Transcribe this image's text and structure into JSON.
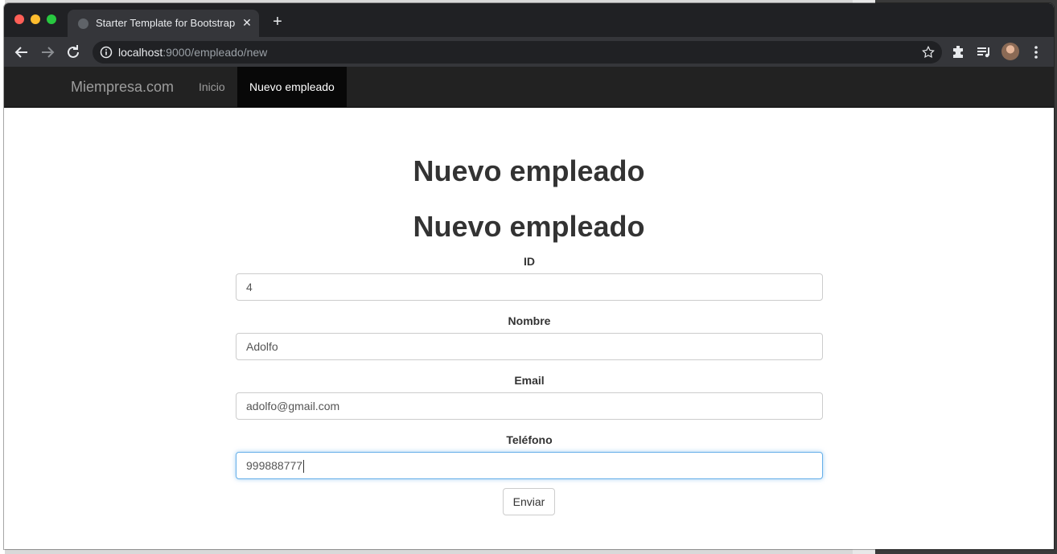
{
  "browser": {
    "tab_title": "Starter Template for Bootstrap",
    "url_host": "localhost",
    "url_path": ":9000/empleado/new",
    "icons": [
      "back-icon",
      "forward-icon",
      "reload-icon",
      "info-icon",
      "star-icon",
      "extensions-icon",
      "media-icon",
      "avatar",
      "menu-icon"
    ]
  },
  "navbar": {
    "brand": "Miempresa.com",
    "links": [
      {
        "label": "Inicio",
        "active": false
      },
      {
        "label": "Nuevo empleado",
        "active": true
      }
    ]
  },
  "main": {
    "heading": "Nuevo empleado",
    "form_heading": "Nuevo empleado",
    "fields": [
      {
        "label": "ID",
        "value": "4"
      },
      {
        "label": "Nombre",
        "value": "Adolfo"
      },
      {
        "label": "Email",
        "value": "adolfo@gmail.com"
      },
      {
        "label": "Teléfono",
        "value": "999888777"
      }
    ],
    "submit_label": "Enviar"
  },
  "colors": {
    "navbar_bg": "#222222",
    "navbar_active_bg": "#080808",
    "focus_border": "#66afe9"
  }
}
